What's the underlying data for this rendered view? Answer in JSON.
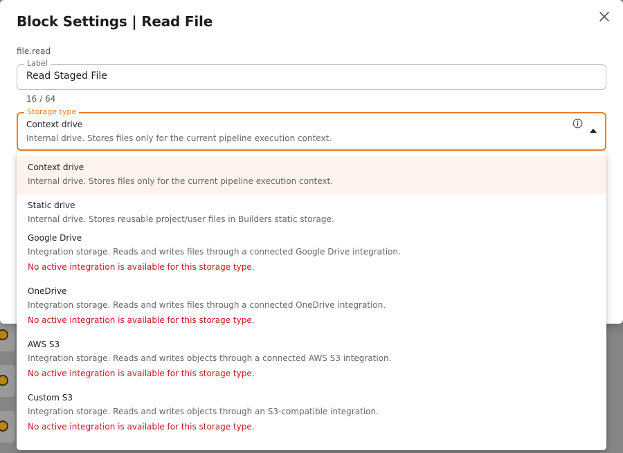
{
  "dialog": {
    "title": "Block Settings | Read File",
    "block_id": "file.read"
  },
  "label_field": {
    "legend": "Label",
    "value": "Read Staged File",
    "char_count": "16 / 64"
  },
  "storage_select": {
    "legend": "Storage type",
    "selected_title": "Context drive",
    "selected_description": "Internal drive. Stores files only for the current pipeline execution context.",
    "info_icon": "info-icon",
    "caret_icon": "caret-up-icon"
  },
  "options": [
    {
      "title": "Context drive",
      "description": "Internal drive. Stores files only for the current pipeline execution context.",
      "warning": ""
    },
    {
      "title": "Static drive",
      "description": "Internal drive. Stores reusable project/user files in Builders static storage.",
      "warning": ""
    },
    {
      "title": "Google Drive",
      "description": "Integration storage. Reads and writes files through a connected Google Drive integration.",
      "warning": "No active integration is available for this storage type."
    },
    {
      "title": "OneDrive",
      "description": "Integration storage. Reads and writes files through a connected OneDrive integration.",
      "warning": "No active integration is available for this storage type."
    },
    {
      "title": "AWS S3",
      "description": "Integration storage. Reads and writes objects through a connected AWS S3 integration.",
      "warning": "No active integration is available for this storage type."
    },
    {
      "title": "Custom S3",
      "description": "Integration storage. Reads and writes objects through an S3-compatible integration.",
      "warning": "No active integration is available for this storage type."
    }
  ],
  "colors": {
    "accent": "#e8802e",
    "selected_bg": "#fdf3ec",
    "warning": "#c4161c"
  }
}
